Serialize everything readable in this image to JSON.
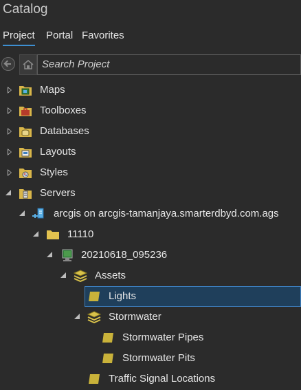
{
  "panel": {
    "title": "Catalog"
  },
  "tabs": [
    {
      "label": "Project",
      "active": true
    },
    {
      "label": "Portal",
      "active": false
    },
    {
      "label": "Favorites",
      "active": false
    }
  ],
  "search": {
    "placeholder": "Search Project"
  },
  "tree": {
    "maps": "Maps",
    "toolboxes": "Toolboxes",
    "databases": "Databases",
    "layouts": "Layouts",
    "styles": "Styles",
    "servers": "Servers",
    "connection": "arcgis on arcgis-tamanjaya.smarterdbyd.com.ags",
    "folder": "11110",
    "service": "20210618_095236",
    "assets": "Assets",
    "lights": "Lights",
    "stormwater": "Stormwater",
    "stormwater_pipes": "Stormwater Pipes",
    "stormwater_pits": "Stormwater Pits",
    "traffic_signal_locations": "Traffic Signal Locations"
  },
  "colors": {
    "background": "#2b2b2b",
    "accent": "#3d8fd1",
    "selection": "#1f3f5b",
    "folder_yellow": "#d9b64a",
    "layer_yellow": "#c9b23a"
  }
}
